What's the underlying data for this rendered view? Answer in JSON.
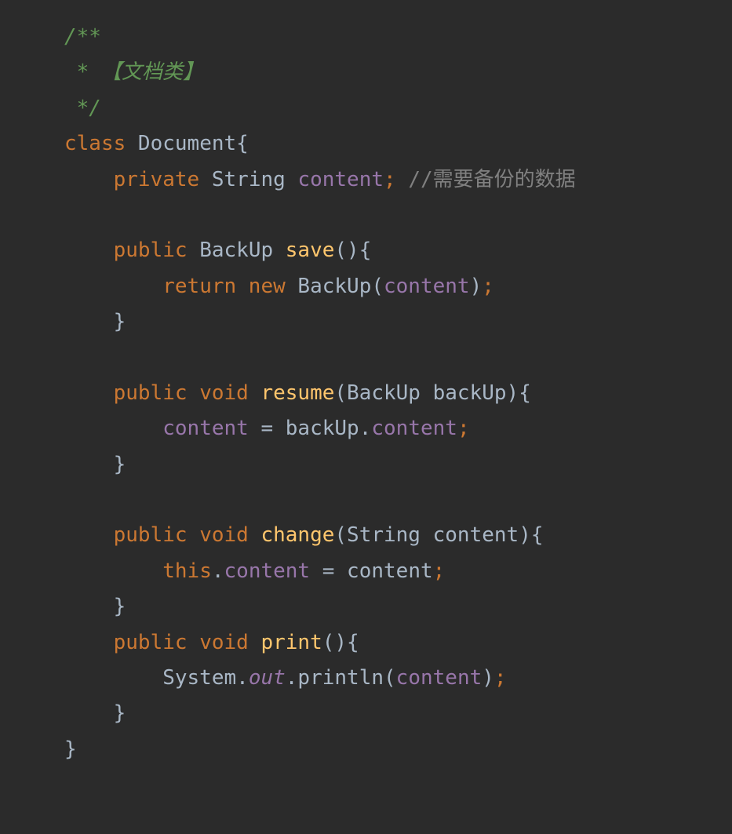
{
  "editor": {
    "language": "java",
    "theme": "darcula",
    "colors": {
      "background": "#2b2b2b",
      "default_text": "#a9b7c6",
      "keyword": "#cc7832",
      "method": "#ffc66d",
      "field": "#9876aa",
      "doc_comment": "#629755",
      "line_comment": "#808080"
    },
    "lines": [
      [
        {
          "t": "cm",
          "v": "/**"
        }
      ],
      [
        {
          "t": "cm",
          "v": " * 【文档类】"
        }
      ],
      [
        {
          "t": "cm",
          "v": " */"
        }
      ],
      [
        {
          "t": "kw",
          "v": "class "
        },
        {
          "t": "tx",
          "v": "Document{"
        }
      ],
      [
        {
          "t": "tx",
          "v": "    "
        },
        {
          "t": "kw",
          "v": "private "
        },
        {
          "t": "tx",
          "v": "String "
        },
        {
          "t": "fld",
          "v": "content"
        },
        {
          "t": "kw",
          "v": "; "
        },
        {
          "t": "lc",
          "v": "//需要备份的数据"
        }
      ],
      [],
      [
        {
          "t": "tx",
          "v": "    "
        },
        {
          "t": "kw",
          "v": "public "
        },
        {
          "t": "tx",
          "v": "BackUp "
        },
        {
          "t": "fn",
          "v": "save"
        },
        {
          "t": "tx",
          "v": "(){"
        }
      ],
      [
        {
          "t": "tx",
          "v": "        "
        },
        {
          "t": "kw",
          "v": "return new "
        },
        {
          "t": "tx",
          "v": "BackUp("
        },
        {
          "t": "fld",
          "v": "content"
        },
        {
          "t": "tx",
          "v": ")"
        },
        {
          "t": "kw",
          "v": ";"
        }
      ],
      [
        {
          "t": "tx",
          "v": "    }"
        }
      ],
      [],
      [
        {
          "t": "tx",
          "v": "    "
        },
        {
          "t": "kw",
          "v": "public void "
        },
        {
          "t": "fn",
          "v": "resume"
        },
        {
          "t": "tx",
          "v": "(BackUp backUp){"
        }
      ],
      [
        {
          "t": "tx",
          "v": "        "
        },
        {
          "t": "fld",
          "v": "content "
        },
        {
          "t": "tx",
          "v": "= backUp."
        },
        {
          "t": "fld",
          "v": "content"
        },
        {
          "t": "kw",
          "v": ";"
        }
      ],
      [
        {
          "t": "tx",
          "v": "    }"
        }
      ],
      [],
      [
        {
          "t": "tx",
          "v": "    "
        },
        {
          "t": "kw",
          "v": "public void "
        },
        {
          "t": "fn",
          "v": "change"
        },
        {
          "t": "tx",
          "v": "(String content){"
        }
      ],
      [
        {
          "t": "tx",
          "v": "        "
        },
        {
          "t": "kw",
          "v": "this"
        },
        {
          "t": "tx",
          "v": "."
        },
        {
          "t": "fld",
          "v": "content "
        },
        {
          "t": "tx",
          "v": "= content"
        },
        {
          "t": "kw",
          "v": ";"
        }
      ],
      [
        {
          "t": "tx",
          "v": "    }"
        }
      ],
      [
        {
          "t": "tx",
          "v": "    "
        },
        {
          "t": "kw",
          "v": "public void "
        },
        {
          "t": "fn",
          "v": "print"
        },
        {
          "t": "tx",
          "v": "(){"
        }
      ],
      [
        {
          "t": "tx",
          "v": "        System."
        },
        {
          "t": "sfld",
          "v": "out"
        },
        {
          "t": "tx",
          "v": ".println("
        },
        {
          "t": "fld",
          "v": "content"
        },
        {
          "t": "tx",
          "v": ")"
        },
        {
          "t": "kw",
          "v": ";"
        }
      ],
      [
        {
          "t": "tx",
          "v": "    }"
        }
      ],
      [
        {
          "t": "tx",
          "v": "}"
        }
      ]
    ]
  }
}
